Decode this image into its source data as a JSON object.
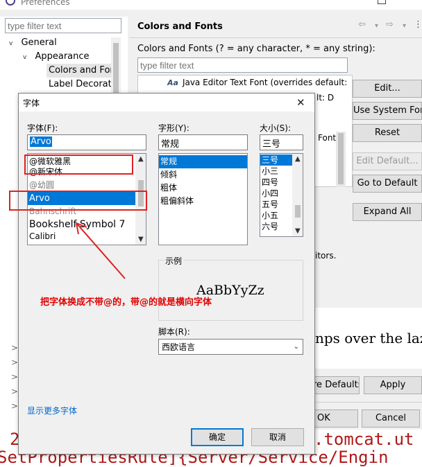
{
  "window": {
    "title": "Preferences"
  },
  "left": {
    "filter_placeholder": "type filter text",
    "tree": [
      {
        "label": "General",
        "twisty": "v"
      },
      {
        "label": "Appearance",
        "twisty": "v"
      },
      {
        "label": "Colors and Fonts",
        "twisty": ""
      },
      {
        "label": "Label Decorations",
        "twisty": ""
      }
    ],
    "left_chevrons": [
      ">",
      ">",
      ">",
      ">",
      ">"
    ]
  },
  "right": {
    "title": "Colors and Fonts",
    "nav_back": "⇦",
    "nav_fwd": "⇨",
    "nav_menu": "⋮",
    "description": "Colors and Fonts (? = any character, * = any string):",
    "filter_placeholder": "type filter text",
    "list_items": [
      {
        "icon": "Aa",
        "label": "Java Editor Text Font (overrides default: Text Font)"
      }
    ],
    "side_text_1": "lt: D",
    "side_text_2": "Font",
    "side_text_3": "itors.",
    "buttons": {
      "edit": "Edit...",
      "use_system_font": "Use System Font",
      "reset": "Reset",
      "edit_default": "Edit Default...",
      "go_to_default": "Go to Default",
      "expand_all": "Expand All",
      "restore_defaults": "re Defaults",
      "apply": "Apply",
      "ok": "OK",
      "cancel": "Cancel"
    },
    "preview_text": "nps over the laz"
  },
  "background_code": {
    "line1_prefix": "2",
    "line1": ".tomcat.ut",
    "line2": "SetPropertiesRule]{Server/Service/Engin"
  },
  "font_dialog": {
    "title": "字体",
    "close_glyph": "✕",
    "font_label": "字体(F):",
    "font_value": "Arvo",
    "font_list": [
      "@微软雅黑",
      "@新宋体",
      "@幼圆",
      "Arvo",
      "Bahnschrift",
      "Bookshelf Symbol 7",
      "Calibri"
    ],
    "font_selected_index": 3,
    "style_label": "字形(Y):",
    "style_value": "常规",
    "style_list": [
      "常规",
      "倾斜",
      "粗体",
      "粗偏斜体"
    ],
    "style_selected_index": 0,
    "size_label": "大小(S):",
    "size_value": "三号",
    "size_list": [
      "三号",
      "小三",
      "四号",
      "小四",
      "五号",
      "小五",
      "六号"
    ],
    "size_selected_index": 0,
    "sample_label": "示例",
    "sample_text": "AaBbYyZz",
    "script_label": "脚本(R):",
    "script_value": "西欧语言",
    "more_fonts_link": "显示更多字体",
    "ok_button": "确定",
    "cancel_button": "取消"
  },
  "annotation": {
    "text": "把字体换成不带@的，带@的就是横向字体",
    "color": "#e00000"
  },
  "colors": {
    "selection": "#0078d7",
    "annotation_red": "#e02020",
    "background_code": "#b01818"
  }
}
